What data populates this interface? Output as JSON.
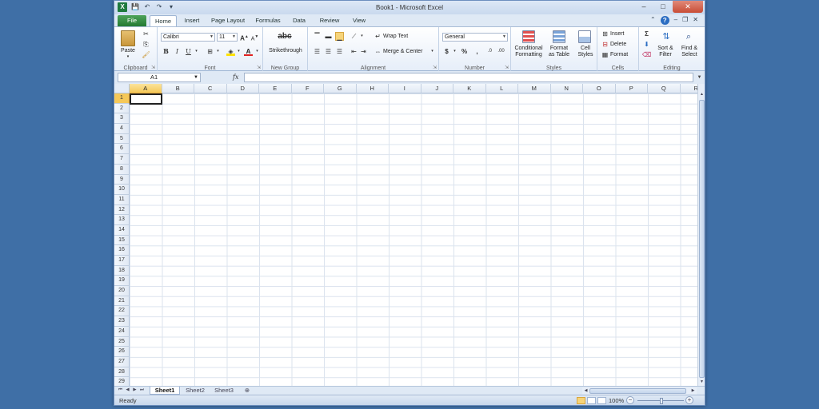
{
  "window": {
    "title": "Book1 - Microsoft Excel",
    "controls": [
      "–",
      "□",
      "✕"
    ]
  },
  "qat": {
    "save": "💾",
    "undo": "↶",
    "redo": "↷",
    "customize": "▾"
  },
  "tabs": [
    {
      "label": "File"
    },
    {
      "label": "Home"
    },
    {
      "label": "Insert"
    },
    {
      "label": "Page Layout"
    },
    {
      "label": "Formulas"
    },
    {
      "label": "Data"
    },
    {
      "label": "Review"
    },
    {
      "label": "View"
    }
  ],
  "ribbon": {
    "clipboard": {
      "label": "Clipboard",
      "paste": "Paste"
    },
    "font": {
      "label": "Font",
      "font_name": "Calibri",
      "font_size": "11",
      "bold": "B",
      "italic": "I",
      "underline": "U"
    },
    "new_group": {
      "label": "New Group",
      "strikethrough": "Strikethrough",
      "abc": "abc"
    },
    "alignment": {
      "label": "Alignment",
      "wrap_text": "Wrap Text",
      "merge_center": "Merge & Center"
    },
    "number": {
      "label": "Number",
      "format": "General",
      "currency": "$",
      "percent": "%",
      "comma": ","
    },
    "styles": {
      "label": "Styles",
      "conditional": "Conditional",
      "conditional2": "Formatting",
      "format_as": "Format",
      "format_as2": "as Table",
      "cell": "Cell",
      "cell2": "Styles"
    },
    "cells": {
      "label": "Cells",
      "insert": "Insert",
      "delete": "Delete",
      "format": "Format"
    },
    "editing": {
      "label": "Editing",
      "sort": "Sort &",
      "sort2": "Filter",
      "find": "Find &",
      "find2": "Select",
      "sigma": "Σ"
    }
  },
  "formula_bar": {
    "name_box": "A1",
    "fx": "fx",
    "value": ""
  },
  "grid": {
    "columns": [
      "A",
      "B",
      "C",
      "D",
      "E",
      "F",
      "G",
      "H",
      "I",
      "J",
      "K",
      "L",
      "M",
      "N",
      "O",
      "P",
      "Q",
      "R"
    ],
    "rows": [
      "1",
      "2",
      "3",
      "4",
      "5",
      "6",
      "7",
      "8",
      "9",
      "10",
      "11",
      "12",
      "13",
      "14",
      "15",
      "16",
      "17",
      "18",
      "19",
      "20",
      "21",
      "22",
      "23",
      "24",
      "25",
      "26",
      "27",
      "28",
      "29"
    ],
    "active_cell": "A1"
  },
  "sheets": [
    {
      "label": "Sheet1",
      "active": true
    },
    {
      "label": "Sheet2",
      "active": false
    },
    {
      "label": "Sheet3",
      "active": false
    }
  ],
  "status": {
    "text": "Ready",
    "zoom": "100%"
  },
  "colors": {
    "accent": "#1f7a3e",
    "background": "#3f6fa6",
    "selection": "#f5c858"
  }
}
